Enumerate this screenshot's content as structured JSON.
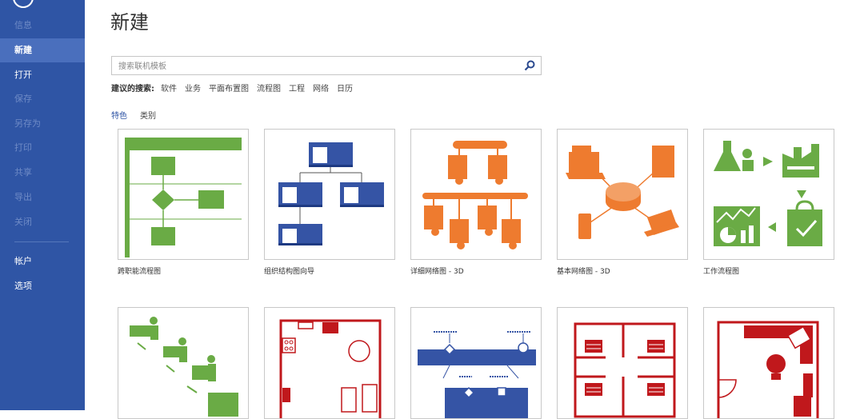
{
  "sidebar": {
    "items": [
      {
        "label": "信息",
        "dim": true
      },
      {
        "label": "新建",
        "active": true
      },
      {
        "label": "打开"
      },
      {
        "label": "保存",
        "dim": true
      },
      {
        "label": "另存为",
        "dim": true
      },
      {
        "label": "打印",
        "dim": true
      },
      {
        "label": "共享",
        "dim": true
      },
      {
        "label": "导出",
        "dim": true
      },
      {
        "label": "关闭",
        "dim": true
      },
      {
        "label": "帐户"
      },
      {
        "label": "选项"
      }
    ]
  },
  "main": {
    "title": "新建",
    "search": {
      "placeholder": "搜索联机模板",
      "value": ""
    },
    "suggested": {
      "label": "建议的搜索:",
      "items": [
        "软件",
        "业务",
        "平面布置图",
        "流程图",
        "工程",
        "网络",
        "日历"
      ]
    },
    "tabs": [
      {
        "label": "特色",
        "active": true
      },
      {
        "label": "类别"
      }
    ],
    "templates": [
      {
        "label": "跨职能流程图"
      },
      {
        "label": "组织结构图向导"
      },
      {
        "label": "详细网络图 - 3D"
      },
      {
        "label": "基本网络图 - 3D"
      },
      {
        "label": "工作流程图"
      }
    ]
  },
  "colors": {
    "sidebar": "#2f55a5",
    "sidebar_active": "#4a6fbd",
    "green": "#6aab45",
    "blue": "#3554a5",
    "orange": "#ee7b2f",
    "red": "#c0181c"
  }
}
